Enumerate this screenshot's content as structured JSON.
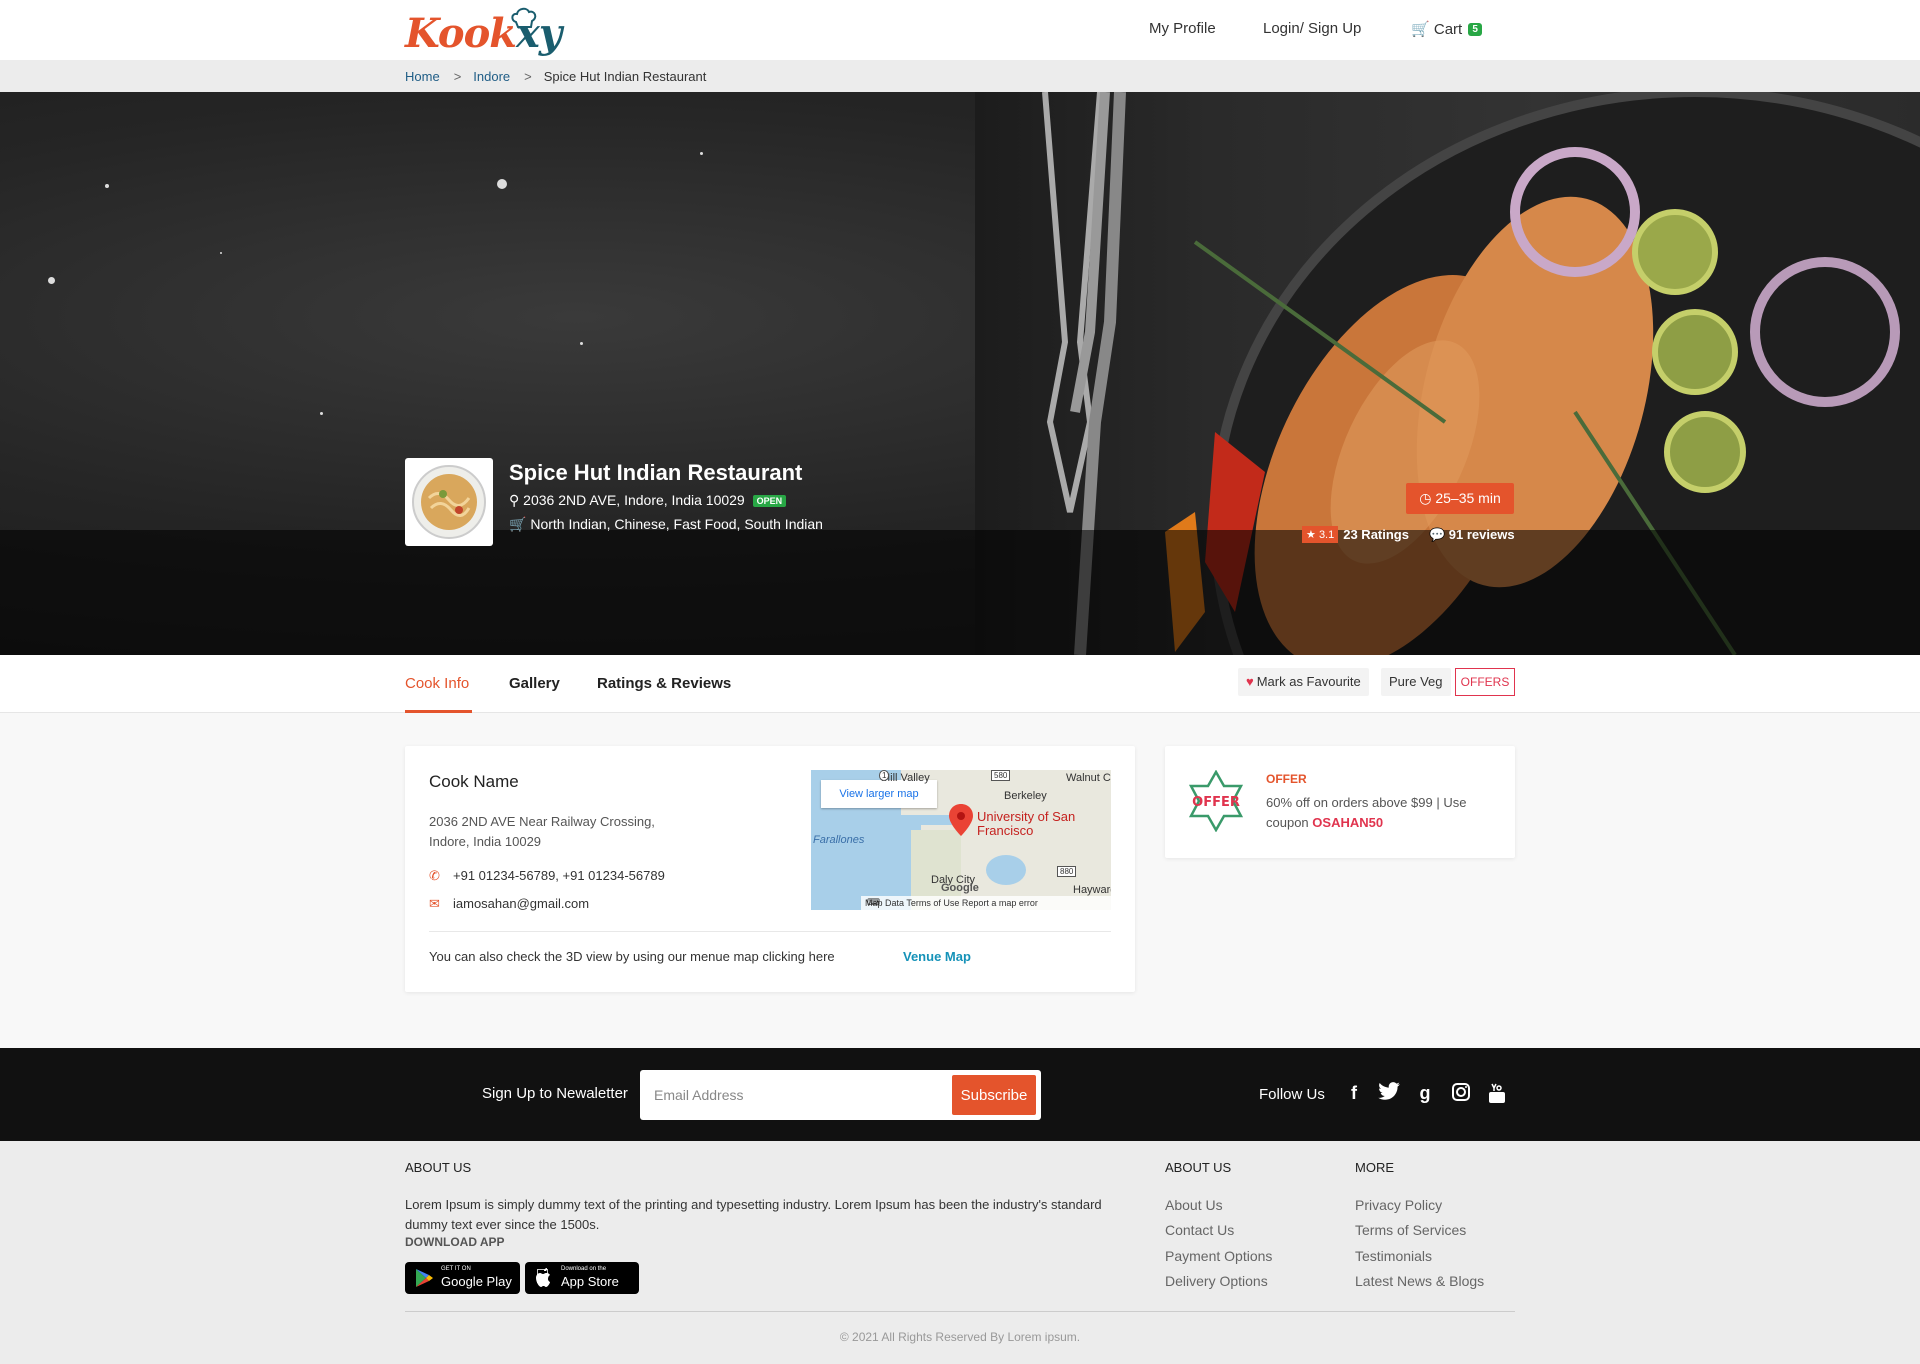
{
  "brand": {
    "logo_main": "Kook",
    "logo_accent": "xy"
  },
  "nav": {
    "profile": "My Profile",
    "login": "Login/ Sign Up",
    "cart": "Cart",
    "cart_count": "5"
  },
  "breadcrumb": {
    "home": "Home",
    "city": "Indore",
    "current": "Spice Hut Indian Restaurant",
    "separator": ">"
  },
  "restaurant": {
    "name": "Spice Hut Indian Restaurant",
    "address": "2036 2ND AVE, Indore, India 10029",
    "status": "OPEN",
    "cuisines": "North Indian, Chinese, Fast Food, South Indian",
    "delivery_time": "25–35 min",
    "rating": "3.1",
    "ratings_count": "23 Ratings",
    "reviews_count": "91 reviews"
  },
  "tabs": {
    "cook_info": "Cook Info",
    "gallery": "Gallery",
    "ratings": "Ratings & Reviews"
  },
  "actions": {
    "favourite": "Mark as Favourite",
    "pure_veg": "Pure Veg",
    "offers": "OFFERS"
  },
  "cook": {
    "title": "Cook Name",
    "address": "2036 2ND AVE Near Railway Crossing, Indore, India 10029",
    "phones": "+91 01234-56789, +91 01234-56789",
    "email": "iamosahan@gmail.com",
    "note": "You can also check the 3D view by using our menue map clicking here",
    "venue_link": "Venue Map"
  },
  "map": {
    "view_larger": "View larger map",
    "labels": [
      "Mill Valley",
      "Walnut C",
      "Berkeley",
      "Farallones",
      "Daly City",
      "Hayward"
    ],
    "pin_label": "University of San Francisco",
    "shields": [
      "580",
      "880",
      "1"
    ],
    "google": "Google",
    "footer": "Map Data    Terms of Use    Report a map error"
  },
  "offer": {
    "badge": "OFFER",
    "title": "OFFER",
    "text": "60% off on orders above $99 | Use coupon",
    "code": "OSAHAN50"
  },
  "newsletter": {
    "label": "Sign Up to Newaletter",
    "placeholder": "Email Address",
    "button": "Subscribe",
    "follow": "Follow Us"
  },
  "footer": {
    "about_heading": "ABOUT US",
    "about_text": "Lorem Ipsum is simply dummy text of the printing and typesetting industry. Lorem Ipsum has been the industry's standard dummy text ever since the 1500s.",
    "download": "DOWNLOAD APP",
    "google_play_small": "GET IT ON",
    "google_play": "Google Play",
    "app_store_small": "Download on the",
    "app_store": "App Store",
    "col2_heading": "ABOUT US",
    "col2_links": [
      "About Us",
      "Contact Us",
      "Payment Options",
      "Delivery Options"
    ],
    "col3_heading": "MORE",
    "col3_links": [
      "Privacy Policy",
      "Terms of Services",
      "Testimonials",
      "Latest News & Blogs"
    ],
    "copyright": "© 2021 All Rights Reserved By Lorem ipsum."
  },
  "colors": {
    "accent": "#e4542c",
    "success": "#28a745",
    "link": "#1592b8",
    "heart": "#e0344e"
  }
}
